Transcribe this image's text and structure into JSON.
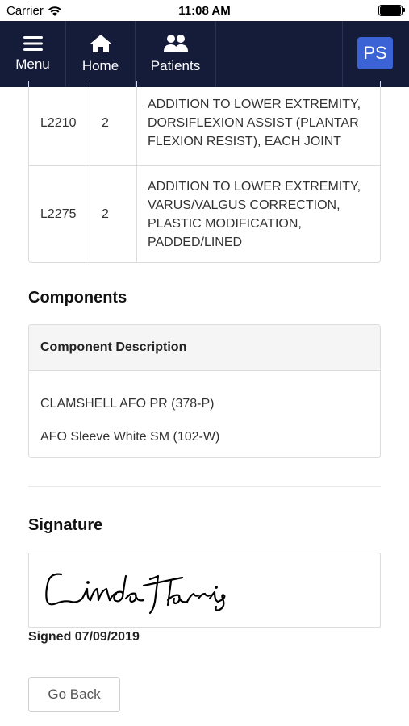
{
  "status_bar": {
    "carrier": "Carrier",
    "time": "11:08 AM"
  },
  "nav": {
    "menu_label": "Menu",
    "home_label": "Home",
    "patients_label": "Patients",
    "avatar_initials": "PS",
    "background": "#141c3a",
    "avatar_color": "#3b63d6"
  },
  "codes": [
    {
      "code": "L2210",
      "qty": "2",
      "description": "ADDITION TO LOWER EXTREMITY, DORSIFLEXION ASSIST (PLANTAR FLEXION RESIST), EACH JOINT"
    },
    {
      "code": "L2275",
      "qty": "2",
      "description": "ADDITION TO LOWER EXTREMITY, VARUS/VALGUS CORRECTION, PLASTIC MODIFICATION, PADDED/LINED"
    }
  ],
  "components": {
    "title": "Components",
    "header": "Component Description",
    "items": [
      "CLAMSHELL AFO PR (378-P)",
      "AFO Sleeve White SM (102-W)"
    ]
  },
  "signature": {
    "title": "Signature",
    "signed_text": "Signed 07/09/2019"
  },
  "go_back_label": "Go Back"
}
